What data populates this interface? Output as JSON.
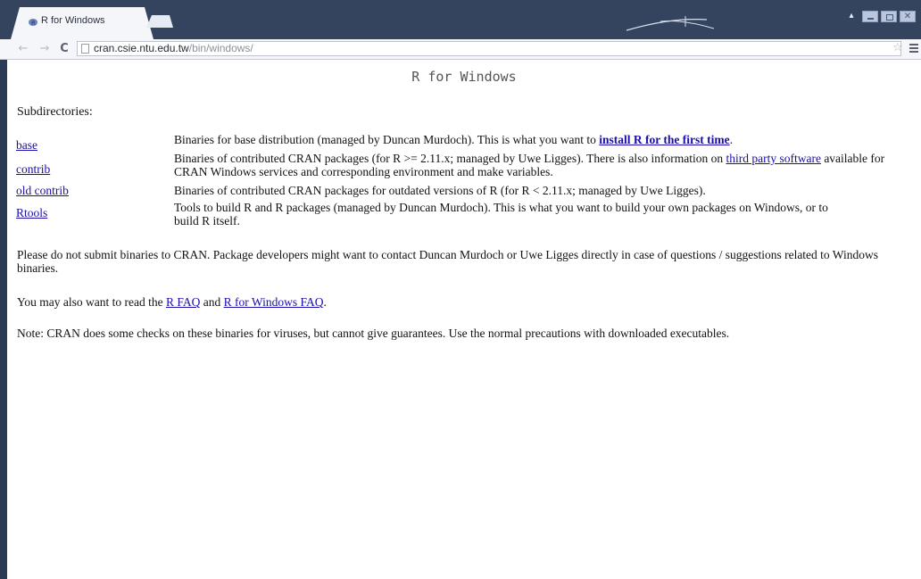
{
  "browser": {
    "tab_title": "R for Windows",
    "tab_close": "×",
    "url_host": "cran.csie.ntu.edu.tw",
    "url_path": "/bin/windows/",
    "back_icon": "←",
    "forward_icon": "→",
    "reload_icon": "C",
    "star_icon": "☆"
  },
  "page": {
    "heading": "R for Windows",
    "subdirectories_label": "Subdirectories:",
    "rows": [
      {
        "name": "base",
        "desc_before": "Binaries for base distribution (managed by Duncan Murdoch). This is what you want to ",
        "desc_link": "install R for the first time",
        "desc_after": "."
      },
      {
        "name": "contrib",
        "desc_before": "Binaries of contributed CRAN packages (for R >= 2.11.x; managed by Uwe Ligges). There is also information on ",
        "desc_link": "third party software",
        "desc_after": " available for CRAN Windows services and corresponding environment and make variables."
      },
      {
        "name": "old contrib",
        "desc_before": "Binaries of contributed CRAN packages for outdated versions of R (for R < 2.11.x; managed by Uwe Ligges).",
        "desc_link": "",
        "desc_after": ""
      },
      {
        "name": "Rtools",
        "desc_before": "Tools to build R and R packages (managed by Duncan Murdoch). This is what you want to build your own packages on Windows, or to build R itself.",
        "desc_link": "",
        "desc_after": ""
      }
    ],
    "para_binaries": "Please do not submit binaries to CRAN. Package developers might want to contact Duncan Murdoch or Uwe Ligges directly in case of questions / suggestions related to Windows binaries.",
    "para_faq_before": "You may also want to read the ",
    "faq_link_1": "R FAQ",
    "para_faq_mid": " and ",
    "faq_link_2": "R for Windows FAQ",
    "para_faq_after": ".",
    "para_note": "Note: CRAN does some checks on these binaries for viruses, but cannot give guarantees. Use the normal precautions with downloaded executables."
  }
}
